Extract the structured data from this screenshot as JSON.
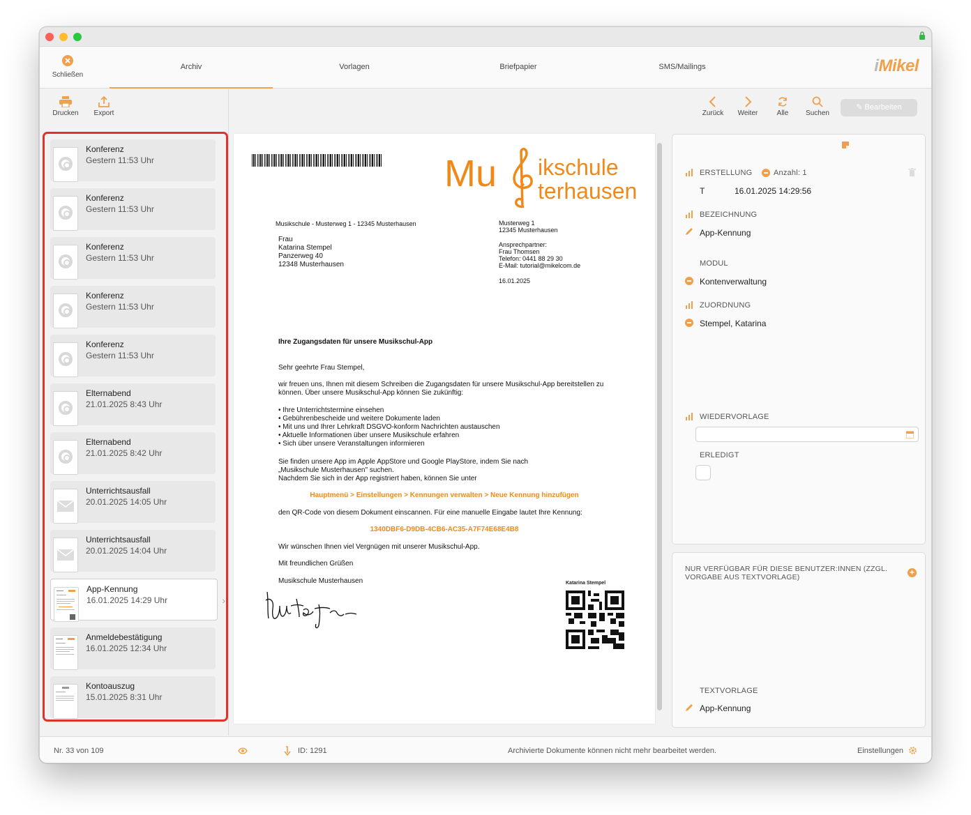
{
  "nav": {
    "close_label": "Schließen",
    "tabs": [
      "Archiv",
      "Vorlagen",
      "Briefpapier",
      "SMS/Mailings"
    ],
    "logo": "Mikel",
    "logo_prefix": "i"
  },
  "toolbar_left": {
    "print_label": "Drucken",
    "export_label": "Export"
  },
  "toolbar_right": {
    "back_label": "Zurück",
    "next_label": "Weiter",
    "all_label": "Alle",
    "search_label": "Suchen",
    "edit_label": "Bearbeiten"
  },
  "list": [
    {
      "title": "Konferenz",
      "date": "Gestern 11:53 Uhr",
      "icon": "at-icon"
    },
    {
      "title": "Konferenz",
      "date": "Gestern 11:53 Uhr",
      "icon": "at-icon"
    },
    {
      "title": "Konferenz",
      "date": "Gestern 11:53 Uhr",
      "icon": "at-icon"
    },
    {
      "title": "Konferenz",
      "date": "Gestern 11:53 Uhr",
      "icon": "at-icon"
    },
    {
      "title": "Konferenz",
      "date": "Gestern 11:53 Uhr",
      "icon": "at-icon"
    },
    {
      "title": "Elternabend",
      "date": "21.01.2025 8:43 Uhr",
      "icon": "at-icon"
    },
    {
      "title": "Elternabend",
      "date": "21.01.2025 8:42 Uhr",
      "icon": "at-icon"
    },
    {
      "title": "Unterrichtsausfall",
      "date": "20.01.2025 14:05 Uhr",
      "icon": "envelope-icon"
    },
    {
      "title": "Unterrichtsausfall",
      "date": "20.01.2025 14:04 Uhr",
      "icon": "envelope-icon"
    },
    {
      "title": "App-Kennung",
      "date": "16.01.2025 14:29 Uhr",
      "icon": "document-icon"
    },
    {
      "title": "Anmeldebestätigung",
      "date": "16.01.2025 12:34 Uhr",
      "icon": "document-icon"
    },
    {
      "title": "Kontoauszug",
      "date": "15.01.2025 8:31 Uhr",
      "icon": "document-icon"
    }
  ],
  "document": {
    "brand_mu": "Mu",
    "brand_line1": "ikschule",
    "brand_line2": "terhausen",
    "sender_line": "Musikschule - Musterweg 1 - 12345 Musterhausen",
    "recipient": "Frau\nKatarina Stempel\nPanzerweg 40\n12348 Musterhausen",
    "school_address": "Musterweg 1\n12345 Musterhausen",
    "contact": "Ansprechpartner:\nFrau Thomsen\nTelefon: 0441 88 29 30\nE-Mail: tutorial@mikelcom.de",
    "date": "16.01.2025",
    "subject": "Ihre Zugangsdaten für unsere Musikschul-App",
    "salutation": "Sehr geehrte Frau Stempel,",
    "intro": "wir freuen uns, Ihnen mit diesem Schreiben die Zugangsdaten für unsere Musikschul-App bereitstellen zu\nkönnen. Über unsere Musikschul-App können Sie zukünftig:",
    "bullets": "• Ihre Unterrichtstermine einsehen\n• Gebührenbescheide und weitere Dokumente laden\n• Mit uns und Ihrer Lehrkraft DSGVO-konform Nachrichten austauschen\n• Aktuelle Informationen über unsere Musikschule erfahren\n• Sich über unsere Veranstaltungen informieren",
    "app_info": "Sie finden unsere App im Apple AppStore und Google PlayStore, indem Sie nach\n„Musikschule Musterhausen\" suchen.\nNachdem Sie sich in der App registriert haben, können Sie unter",
    "menu_path": "Hauptmenü > Einstellungen > Kennungen verwalten > Neue Kennung hinzufügen",
    "qr_info": "den QR-Code von diesem Dokument einscannen. Für eine manuelle Eingabe lautet Ihre Kennung:",
    "code": "1340DBF6-D9DB-4CB6-AC35-A7F74E68E4B8",
    "wish": "Wir wünschen Ihnen viel Vergnügen mit unserer Musikschul-App.",
    "closing": "Mit freundlichen Grüßen",
    "signer": "Musikschule Musterhausen",
    "qr_label": "Katarina Stempel"
  },
  "details": {
    "erstellung_label": "ERSTELLUNG",
    "anzahl": "Anzahl: 1",
    "erstellung_user": "T",
    "erstellung_date": "16.01.2025 14:29:56",
    "bezeichnung_label": "BEZEICHNUNG",
    "bezeichnung_value": "App-Kennung",
    "modul_label": "MODUL",
    "modul_value": "Kontenverwaltung",
    "zuordnung_label": "ZUORDNUNG",
    "zuordnung_value": "Stempel, Katarina",
    "wiedervorlage_label": "WIEDERVORLAGE",
    "erledigt_label": "ERLEDIGT",
    "users_label": "NUR VERFÜGBAR FÜR DIESE BENUTZER:INNEN (ZZGL.\nVORGABE AUS TEXTVORLAGE)",
    "textvorlage_label": "TEXTVORLAGE",
    "textvorlage_value": "App-Kennung"
  },
  "status": {
    "record": "Nr. 33 von 109",
    "id": "ID: 1291",
    "message": "Archivierte Dokumente können nicht mehr bearbeitet werden.",
    "settings": "Einstellungen"
  },
  "colors": {
    "accent": "#f0a04b",
    "brand": "#ef8a1a",
    "highlight": "#e0322b"
  }
}
